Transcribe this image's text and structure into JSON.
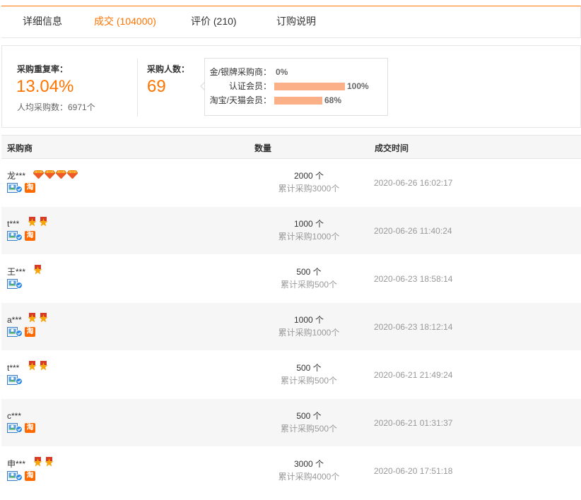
{
  "tabs": [
    {
      "label": "详细信息"
    },
    {
      "label": "成交 (104000)"
    },
    {
      "label": "评价 (210)"
    },
    {
      "label": "订购说明"
    }
  ],
  "stats": {
    "repeat_rate_label": "采购重复率：",
    "repeat_rate_value": "13.04%",
    "avg_purchase_label": "人均采购数：6971个",
    "buyers_label": "采购人数：",
    "buyers_value": "69",
    "distribution": [
      {
        "label": "金/银牌采购商：",
        "percent_text": "0%",
        "fraction": 0.0
      },
      {
        "label": "认证会员：",
        "percent_text": "100%",
        "fraction": 1.0
      },
      {
        "label": "淘宝/天猫会员：",
        "percent_text": "68%",
        "fraction": 0.68
      }
    ],
    "bar_color": "#fbb088"
  },
  "table": {
    "headers": {
      "buyer": "采购商",
      "quantity": "数量",
      "time": "成交时间"
    },
    "rows": [
      {
        "buyer": "龙***",
        "medal_type": "diamond",
        "medal_count": 4,
        "taobao": true,
        "quantity": "2000 个",
        "total": "累计采购3000个",
        "time": "2020-06-26 16:02:17"
      },
      {
        "buyer": "t***",
        "medal_type": "star",
        "medal_count": 2,
        "taobao": true,
        "quantity": "1000 个",
        "total": "累计采购1000个",
        "time": "2020-06-26 11:40:24"
      },
      {
        "buyer": "王***",
        "medal_type": "star",
        "medal_count": 1,
        "taobao": false,
        "quantity": "500 个",
        "total": "累计采购500个",
        "time": "2020-06-23 18:58:14"
      },
      {
        "buyer": "a***",
        "medal_type": "star",
        "medal_count": 2,
        "taobao": true,
        "quantity": "1000 个",
        "total": "累计采购1000个",
        "time": "2020-06-23 18:12:14"
      },
      {
        "buyer": "t***",
        "medal_type": "star",
        "medal_count": 2,
        "taobao": false,
        "quantity": "500 个",
        "total": "累计采购500个",
        "time": "2020-06-21 21:49:24"
      },
      {
        "buyer": "c***",
        "medal_type": "none",
        "medal_count": 0,
        "taobao": true,
        "quantity": "500 个",
        "total": "累计采购500个",
        "time": "2020-06-21 01:31:37"
      },
      {
        "buyer": "申***",
        "medal_type": "star",
        "medal_count": 2,
        "taobao": true,
        "quantity": "3000 个",
        "total": "累计采购4000个",
        "time": "2020-06-20 17:51:18"
      }
    ]
  },
  "icons": {
    "medal_star": "medal-star-icon",
    "medal_diamond": "diamond-icon",
    "verified_avatar": "verified-avatar-icon",
    "taobao": "taobao-icon",
    "taobao_glyph": "淘"
  },
  "colors": {
    "accent": "#ff7300",
    "muted": "#999999"
  }
}
